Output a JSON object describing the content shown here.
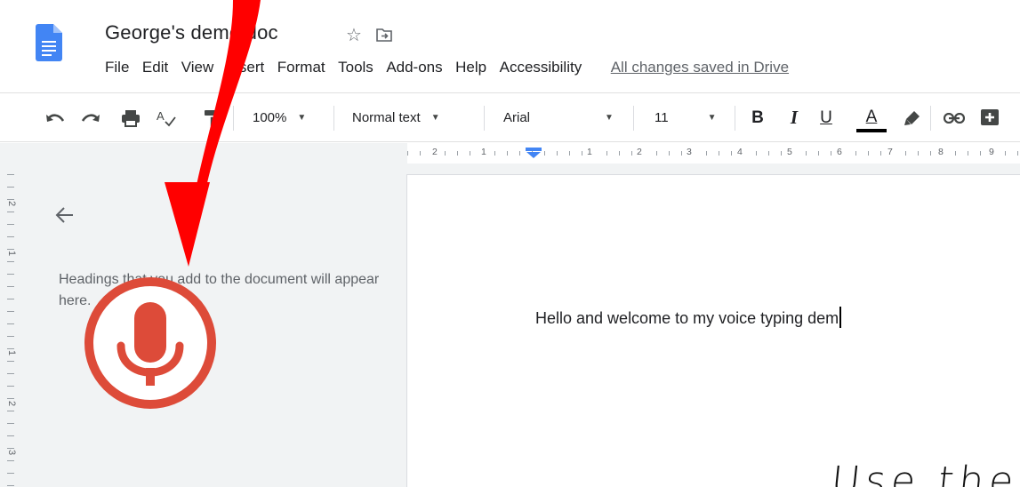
{
  "document": {
    "title": "George's demo doc",
    "save_status": "All changes saved in Drive"
  },
  "menu": [
    "File",
    "Edit",
    "View",
    "Insert",
    "Format",
    "Tools",
    "Add-ons",
    "Help",
    "Accessibility"
  ],
  "toolbar": {
    "zoom": "100%",
    "style": "Normal text",
    "font": "Arial",
    "font_size": "11",
    "bold": "B",
    "italic": "I",
    "underline": "U",
    "text_color_letter": "A"
  },
  "ruler": {
    "horizontal": [
      "2",
      "1",
      "1",
      "2",
      "3",
      "4",
      "5",
      "6",
      "7",
      "8",
      "9"
    ],
    "vertical": [
      "2",
      "1",
      "1",
      "2",
      "3"
    ]
  },
  "outline": {
    "hint": "Headings that you add to the document will appear here."
  },
  "body": {
    "text": "Hello and welcome to my voice typing dem"
  },
  "annotation": {
    "caption": "Use the"
  },
  "icons": {
    "docs_logo": "google-docs-logo",
    "star": "star-icon",
    "move": "move-to-folder-icon",
    "mic": "microphone-icon",
    "arrow": "red-pointer-arrow"
  },
  "colors": {
    "mic": "#dd4b39",
    "arrow": "#ff0000",
    "docs_blue": "#4285f4",
    "ruler_marker": "#4285f4"
  }
}
